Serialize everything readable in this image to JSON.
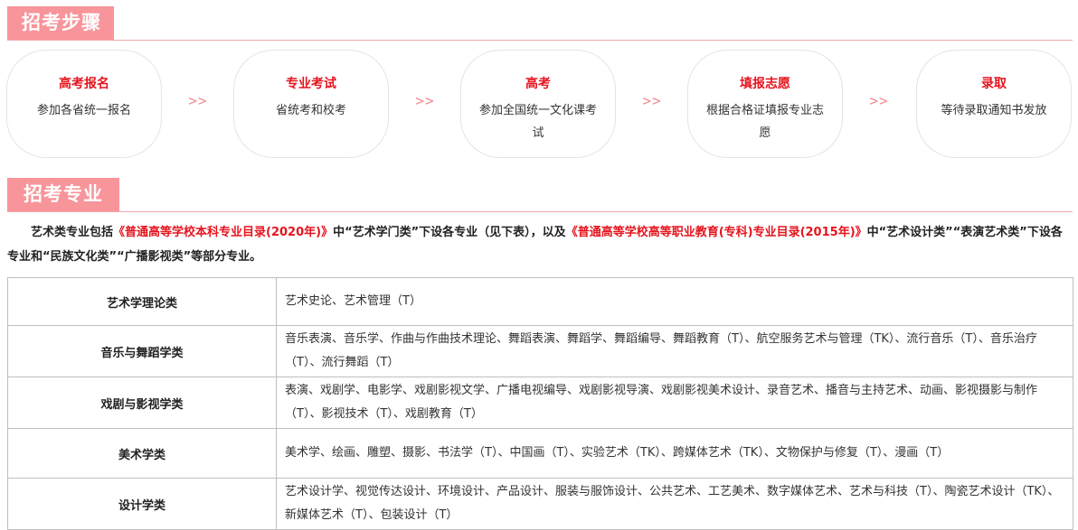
{
  "sections": {
    "steps_title": "招考步骤",
    "majors_title": "招考专业"
  },
  "steps": [
    {
      "title": "高考报名",
      "desc": "参加各省统一报名"
    },
    {
      "title": "专业考试",
      "desc": "省统考和校考"
    },
    {
      "title": "高考",
      "desc": "参加全国统一文化课考试"
    },
    {
      "title": "填报志愿",
      "desc": "根据合格证填报专业志愿"
    },
    {
      "title": "录取",
      "desc": "等待录取通知书发放"
    }
  ],
  "arrow": ">>",
  "intro": {
    "part1": "艺术类专业包括",
    "catalog1": "《普通高等学校本科专业目录(2020年)》",
    "part2": "中“艺术学门类”下设各专业（见下表），以及",
    "catalog2": "《普通高等学校高等职业教育(专科)专业目录(2015年)》",
    "part3": "中“艺术设计类”“表演艺术类”下设各专业和“民族文化类”“广播影视类”等部分专业。"
  },
  "majors": [
    {
      "category": "艺术学理论类",
      "list": "艺术史论、艺术管理（T）"
    },
    {
      "category": "音乐与舞蹈学类",
      "list": "音乐表演、音乐学、作曲与作曲技术理论、舞蹈表演、舞蹈学、舞蹈编导、舞蹈教育（T）、航空服务艺术与管理（TK）、流行音乐（T）、音乐治疗（T）、流行舞蹈（T）"
    },
    {
      "category": "戏剧与影视学类",
      "list": "表演、戏剧学、电影学、戏剧影视文学、广播电视编导、戏剧影视导演、戏剧影视美术设计、录音艺术、播音与主持艺术、动画、影视摄影与制作（T）、影视技术（T）、戏剧教育（T）"
    },
    {
      "category": "美术学类",
      "list": "美术学、绘画、雕塑、摄影、书法学（T）、中国画（T）、实验艺术（TK）、跨媒体艺术（TK）、文物保护与修复（T）、漫画（T）"
    },
    {
      "category": "设计学类",
      "list": "艺术设计学、视觉传达设计、环境设计、产品设计、服装与服饰设计、公共艺术、工艺美术、数字媒体艺术、艺术与科技（T）、陶瓷艺术设计（TK）、新媒体艺术（T）、包装设计（T）"
    }
  ],
  "colors": {
    "accent": "#f8959b",
    "highlight": "#e6141e",
    "border": "#bfbfbf"
  }
}
